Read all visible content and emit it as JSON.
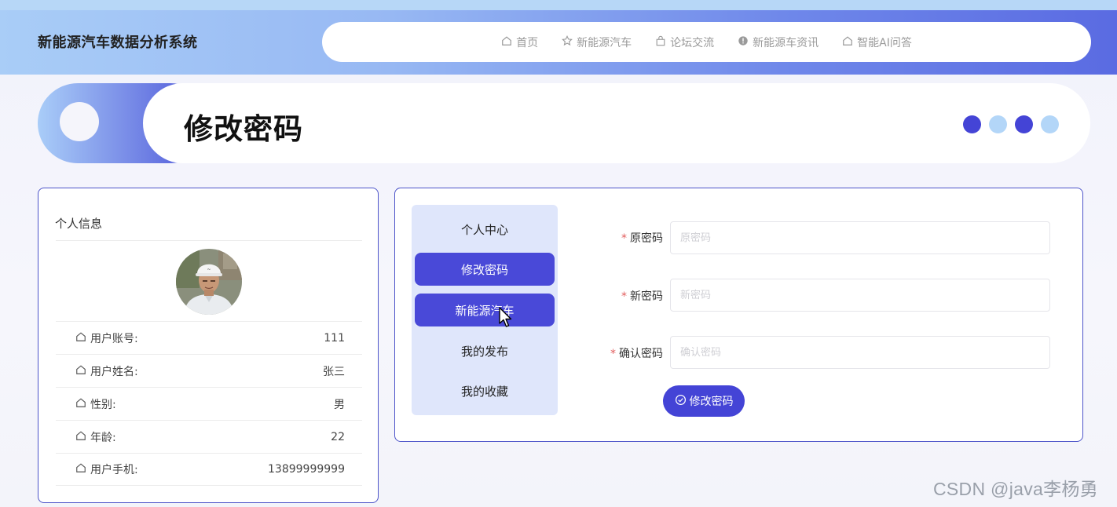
{
  "header": {
    "site_title": "新能源汽车数据分析系统",
    "nav": [
      {
        "label": "首页",
        "icon": "home-icon"
      },
      {
        "label": "新能源汽车",
        "icon": "star-icon"
      },
      {
        "label": "论坛交流",
        "icon": "bag-icon"
      },
      {
        "label": "新能源车资讯",
        "icon": "info-circle-icon"
      },
      {
        "label": "智能AI问答",
        "icon": "home-icon"
      }
    ]
  },
  "banner": {
    "title": "修改密码",
    "dot_colors": [
      "#4444d6",
      "#b3d6f8",
      "#4444d6",
      "#b3d6f8"
    ]
  },
  "profile": {
    "title": "个人信息",
    "rows": [
      {
        "label": "用户账号:",
        "value": "111"
      },
      {
        "label": "用户姓名:",
        "value": "张三"
      },
      {
        "label": "性别:",
        "value": "男"
      },
      {
        "label": "年龄:",
        "value": "22"
      },
      {
        "label": "用户手机:",
        "value": "13899999999"
      }
    ]
  },
  "menu": {
    "items": [
      {
        "label": "个人中心",
        "active": false
      },
      {
        "label": "修改密码",
        "active": true
      },
      {
        "label": "新能源汽车",
        "active": true
      },
      {
        "label": "我的发布",
        "active": false
      },
      {
        "label": "我的收藏",
        "active": false
      }
    ]
  },
  "form": {
    "fields": [
      {
        "label": "原密码",
        "placeholder": "原密码",
        "value": ""
      },
      {
        "label": "新密码",
        "placeholder": "新密码",
        "value": ""
      },
      {
        "label": "确认密码",
        "placeholder": "确认密码",
        "value": ""
      }
    ],
    "submit_label": "修改密码"
  },
  "watermark": "CSDN @java李杨勇",
  "colors": {
    "accent": "#4444d6",
    "light_accent": "#b3d6f8",
    "menu_bg": "#dfe6fb",
    "required": "#e25d5d"
  }
}
